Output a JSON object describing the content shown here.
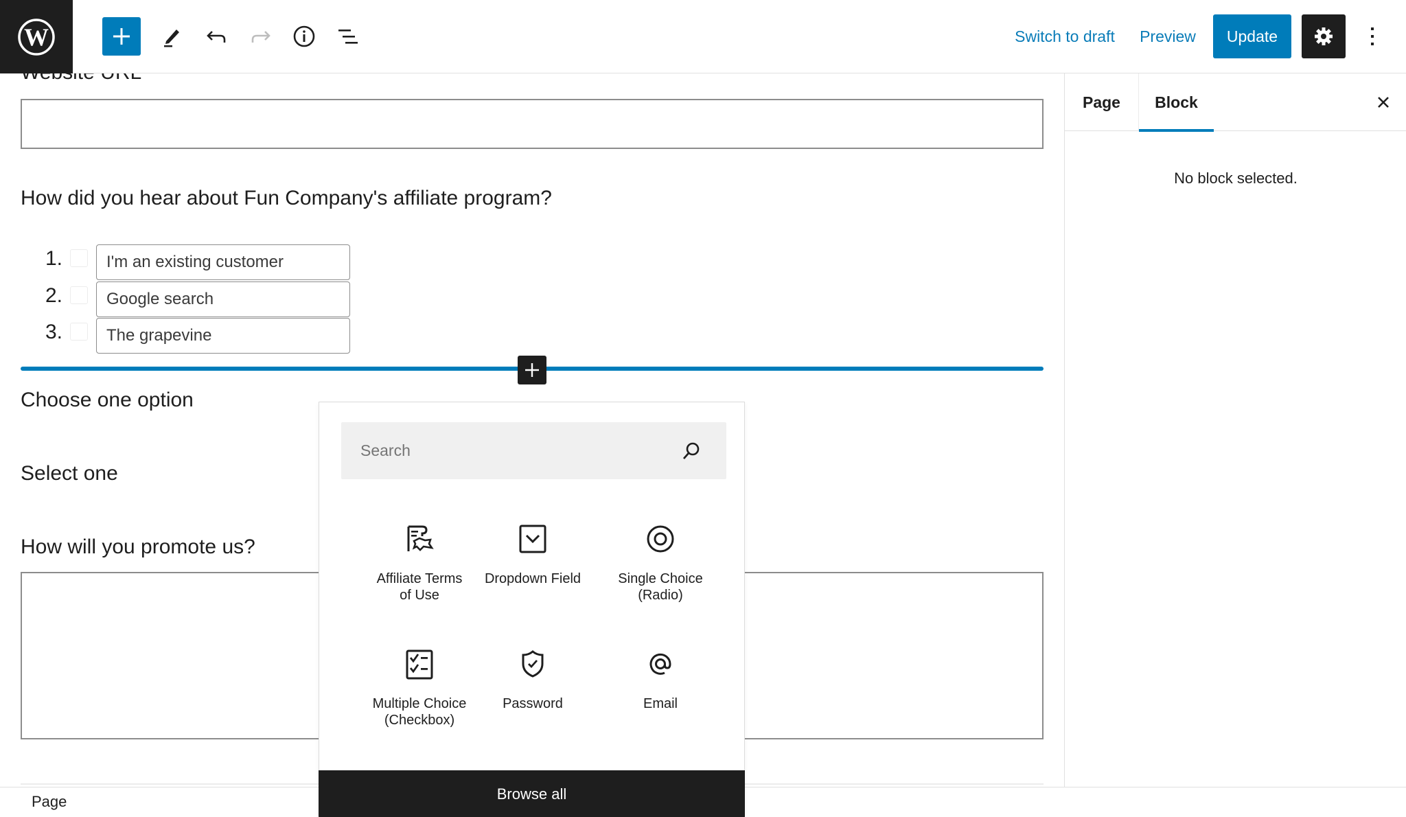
{
  "header": {
    "logo_icon": "wordpress-logo-icon",
    "toolbar_icons": [
      "plus-icon",
      "pencil-icon",
      "undo-icon",
      "redo-icon",
      "info-icon",
      "list-view-icon"
    ],
    "switch_to_draft": "Switch to draft",
    "preview": "Preview",
    "update": "Update",
    "settings_icon": "gear-icon",
    "options_icon": "more-vertical-icon"
  },
  "canvas": {
    "website_url_label": "Website URL",
    "website_url_value": "",
    "hear_about_label": "How did you hear about Fun Company's affiliate program?",
    "hear_about_options": [
      {
        "number": "1.",
        "text": "I'm an existing customer",
        "checked": false
      },
      {
        "number": "2.",
        "text": "Google search",
        "checked": false
      },
      {
        "number": "3.",
        "text": "The grapevine",
        "checked": false
      }
    ],
    "choose_one_label": "Choose one option",
    "select_one_label": "Select one",
    "promote_label": "How will you promote us?",
    "promote_value": ""
  },
  "inserter": {
    "search_placeholder": "Search",
    "search_value": "",
    "blocks": [
      {
        "label": "Affiliate Terms of Use",
        "icon": "affiliate-terms-icon"
      },
      {
        "label": "Dropdown Field",
        "icon": "dropdown-icon"
      },
      {
        "label": "Single Choice (Radio)",
        "icon": "radio-icon"
      },
      {
        "label": "Multiple Choice (Checkbox)",
        "icon": "checklist-icon"
      },
      {
        "label": "Password",
        "icon": "shield-check-icon"
      },
      {
        "label": "Email",
        "icon": "at-sign-icon"
      }
    ],
    "browse_all": "Browse all"
  },
  "sidebar": {
    "tabs": [
      {
        "label": "Page",
        "active": false
      },
      {
        "label": "Block",
        "active": true
      }
    ],
    "empty_message": "No block selected.",
    "close_icon": "close-icon"
  },
  "statusbar": {
    "breadcrumb": "Page"
  },
  "colors": {
    "accent": "#007cba",
    "link": "#0a7cb8",
    "dark": "#1e1e1e"
  }
}
